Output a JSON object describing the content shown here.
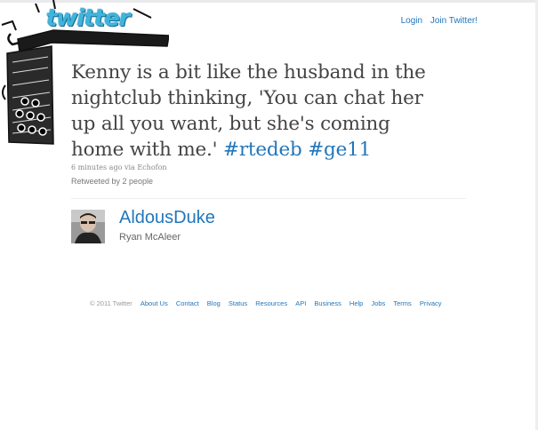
{
  "brand": {
    "logo_text": "twitter",
    "accent": "#3fb4dd",
    "link_color": "#2276bb"
  },
  "header": {
    "login": "Login",
    "join": "Join Twitter!"
  },
  "tweet": {
    "text_plain": "Kenny is a bit like the husband in the nightclub thinking, 'You can chat her up all you want, but she's coming home with me.' ",
    "hashtags": [
      "#rtedeb",
      "#ge11"
    ],
    "time": "6 minutes ago",
    "via": "via",
    "source": "Echofon",
    "retweeted": "Retweeted by 2 people"
  },
  "user": {
    "screen_name": "AldousDuke",
    "real_name": "Ryan McAleer",
    "avatar_icon": "user-photo"
  },
  "footer": {
    "copyright": "© 2011 Twitter",
    "links": [
      "About Us",
      "Contact",
      "Blog",
      "Status",
      "Resources",
      "API",
      "Business",
      "Help",
      "Jobs",
      "Terms",
      "Privacy"
    ]
  }
}
